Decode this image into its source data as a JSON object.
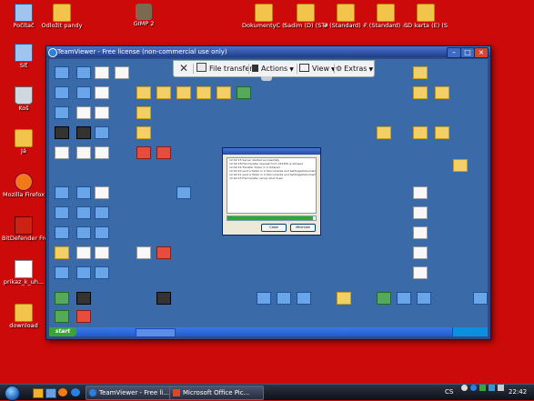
{
  "desktop_left_icons": [
    {
      "label": "Počítač",
      "kind": "pc"
    },
    {
      "label": "Síť",
      "kind": "pc"
    },
    {
      "label": "Koš",
      "kind": "bin"
    },
    {
      "label": "Já",
      "kind": "folder"
    },
    {
      "label": "Mozilla Firefox",
      "kind": "ff"
    },
    {
      "label": "BitDefender Free Edit...",
      "kind": "defender"
    },
    {
      "label": "prikaz_k_uh...",
      "kind": "paper"
    },
    {
      "label": "download",
      "kind": "folder"
    }
  ],
  "desktop_top_icons": [
    {
      "label": "Odložit pandy",
      "kind": "folder"
    },
    {
      "label": "GIMP 2",
      "kind": "gimp"
    },
    {
      "label": "DokumentyC (STANDAX...",
      "kind": "folder"
    },
    {
      "label": "Sadim (D) (STANDAX...",
      "kind": "folder"
    },
    {
      "label": "e (Standard) - zástupce",
      "kind": "folder"
    },
    {
      "label": "F (Standard) - zástupce",
      "kind": "folder"
    },
    {
      "label": "SD karta (E) (STANDAX...",
      "kind": "folder"
    }
  ],
  "teamviewer": {
    "title": "TeamViewer - Free license (non-commercial use only)",
    "toolbar": {
      "close_icon": "close-x-icon",
      "file_transfer": "File transfer",
      "actions": "Actions",
      "view": "View",
      "extras": "Extras"
    },
    "dialog_lines": [
      "12:02:15 Server started successfully",
      "12:02:18 File transfer request from 123456 is allowed",
      "12:02:19 Transfer folder in C:\\Shared",
      "12:02:20 sent a folder in C:\\Documents and Settings\\Dokumenty",
      "12:02:21 sent a folder in C:\\Documents and Settings\\Dokumenty\\04",
      "12:02:23 File transfer server shut down"
    ],
    "dialog_progress": 0.97,
    "dialog_buttons": [
      "Close",
      "Minimize"
    ]
  },
  "taskbar": {
    "buttons": [
      {
        "label": "TeamViewer - Free li..."
      },
      {
        "label": "Microsoft Office Pic..."
      }
    ],
    "lang": "CS",
    "clock": "22:42"
  }
}
